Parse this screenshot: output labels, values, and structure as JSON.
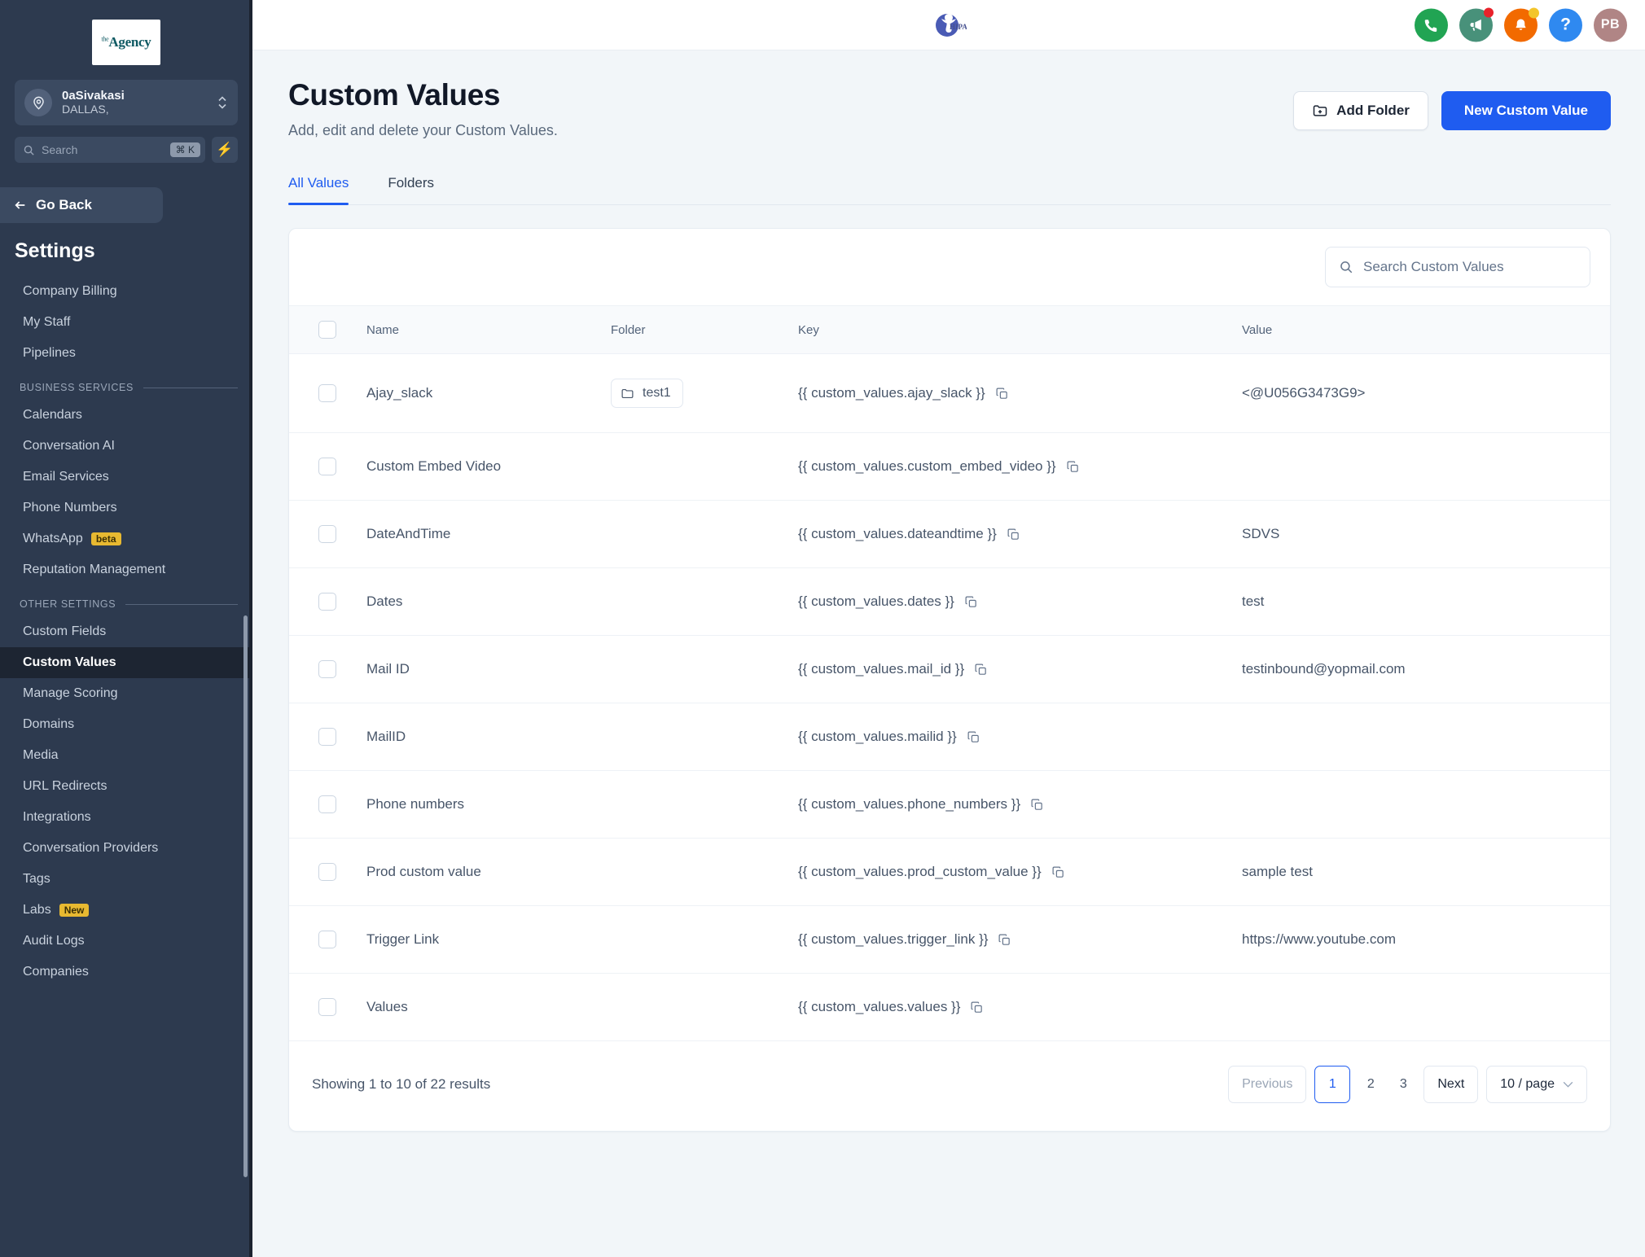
{
  "sidebar": {
    "logo": {
      "sup": "the",
      "name": "Agency"
    },
    "location": {
      "name": "0aSivakasi",
      "sub": "DALLAS,"
    },
    "search": {
      "placeholder": "Search",
      "shortcut": "⌘ K"
    },
    "go_back": "Go Back",
    "section_title": "Settings",
    "items": [
      {
        "label": "Company Billing",
        "active": false
      },
      {
        "label": "My Staff",
        "active": false
      },
      {
        "label": "Pipelines",
        "active": false
      }
    ],
    "group_business": "BUSINESS SERVICES",
    "business_items": [
      {
        "label": "Calendars",
        "active": false,
        "badge": ""
      },
      {
        "label": "Conversation AI",
        "active": false,
        "badge": ""
      },
      {
        "label": "Email Services",
        "active": false,
        "badge": ""
      },
      {
        "label": "Phone Numbers",
        "active": false,
        "badge": ""
      },
      {
        "label": "WhatsApp",
        "active": false,
        "badge": "beta"
      },
      {
        "label": "Reputation Management",
        "active": false,
        "badge": ""
      }
    ],
    "group_other": "OTHER SETTINGS",
    "other_items": [
      {
        "label": "Custom Fields",
        "active": false,
        "badge": ""
      },
      {
        "label": "Custom Values",
        "active": true,
        "badge": ""
      },
      {
        "label": "Manage Scoring",
        "active": false,
        "badge": ""
      },
      {
        "label": "Domains",
        "active": false,
        "badge": ""
      },
      {
        "label": "Media",
        "active": false,
        "badge": ""
      },
      {
        "label": "URL Redirects",
        "active": false,
        "badge": ""
      },
      {
        "label": "Integrations",
        "active": false,
        "badge": ""
      },
      {
        "label": "Conversation Providers",
        "active": false,
        "badge": ""
      },
      {
        "label": "Tags",
        "active": false,
        "badge": ""
      },
      {
        "label": "Labs",
        "active": false,
        "badge": "New"
      },
      {
        "label": "Audit Logs",
        "active": false,
        "badge": ""
      },
      {
        "label": "Companies",
        "active": false,
        "badge": ""
      }
    ]
  },
  "topbar": {
    "brand_logo": "hipaa-logo",
    "avatar_initials": "PB",
    "help_label": "?"
  },
  "page": {
    "title": "Custom Values",
    "subtitle": "Add, edit and delete your Custom Values.",
    "add_folder_label": "Add Folder",
    "new_value_label": "New Custom Value"
  },
  "tabs": [
    {
      "label": "All Values",
      "active": true
    },
    {
      "label": "Folders",
      "active": false
    }
  ],
  "table": {
    "search_placeholder": "Search Custom Values",
    "columns": [
      "Name",
      "Folder",
      "Key",
      "Value"
    ],
    "rows": [
      {
        "name": "Ajay_slack",
        "folder": "test1",
        "key": "{{ custom_values.ajay_slack }}",
        "value": "<@U056G3473G9>"
      },
      {
        "name": "Custom Embed Video",
        "folder": "",
        "key": "{{ custom_values.custom_embed_video }}",
        "value": ""
      },
      {
        "name": "DateAndTime",
        "folder": "",
        "key": "{{ custom_values.dateandtime }}",
        "value": "SDVS"
      },
      {
        "name": "Dates",
        "folder": "",
        "key": "{{ custom_values.dates }}",
        "value": "test"
      },
      {
        "name": "Mail ID",
        "folder": "",
        "key": "{{ custom_values.mail_id }}",
        "value": "testinbound@yopmail.com"
      },
      {
        "name": "MailID",
        "folder": "",
        "key": "{{ custom_values.mailid }}",
        "value": ""
      },
      {
        "name": "Phone numbers",
        "folder": "",
        "key": "{{ custom_values.phone_numbers }}",
        "value": ""
      },
      {
        "name": "Prod custom value",
        "folder": "",
        "key": "{{ custom_values.prod_custom_value }}",
        "value": "sample test"
      },
      {
        "name": "Trigger Link",
        "folder": "",
        "key": "{{ custom_values.trigger_link }}",
        "value": "https://www.youtube.com"
      },
      {
        "name": "Values",
        "folder": "",
        "key": "{{ custom_values.values }}",
        "value": ""
      }
    ]
  },
  "pagination": {
    "showing": "Showing 1 to 10 of 22 results",
    "previous": "Previous",
    "next": "Next",
    "pages": [
      "1",
      "2",
      "3"
    ],
    "current_page": "1",
    "per_page": "10 / page"
  },
  "colors": {
    "accent": "#1f5cf0",
    "sidebar_bg": "#2d3a4f",
    "badge": "#e8b931"
  }
}
